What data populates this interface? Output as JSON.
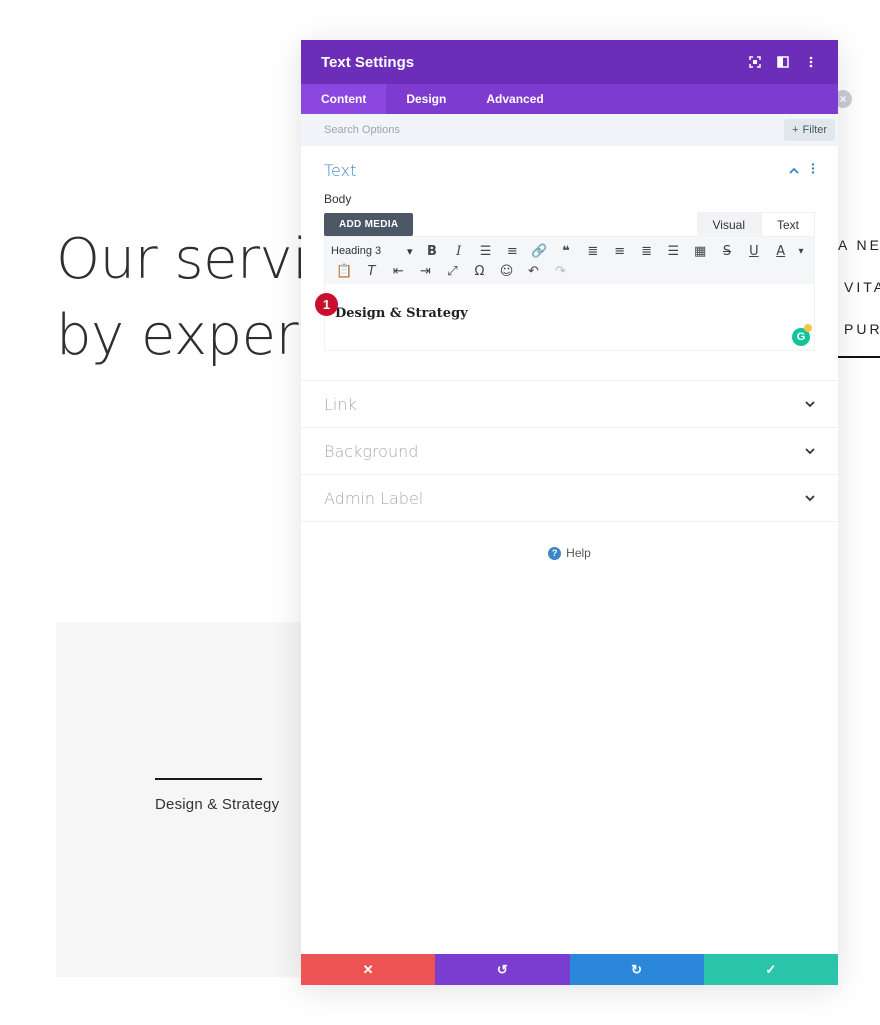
{
  "page": {
    "heading_line1": "Our servi",
    "heading_line2": "by expert",
    "card_text": "Design & Strategy",
    "right_texts": [
      "A NEC",
      "VITA",
      "PURU"
    ]
  },
  "modal": {
    "title": "Text Settings",
    "icons": [
      "focus-icon",
      "split-view-icon",
      "more-icon"
    ],
    "tabs": [
      {
        "label": "Content",
        "active": true
      },
      {
        "label": "Design",
        "active": false
      },
      {
        "label": "Advanced",
        "active": false
      }
    ],
    "search": {
      "placeholder": "Search Options"
    },
    "filter_label": "Filter",
    "text_section": {
      "title": "Text",
      "body_label": "Body",
      "add_media": "ADD MEDIA",
      "editor_tabs": {
        "visual": "Visual",
        "text": "Text"
      },
      "format_select": "Heading 3",
      "content": "Design & Strategy",
      "step_badge": "1"
    },
    "sections": [
      {
        "title": "Link"
      },
      {
        "title": "Background"
      },
      {
        "title": "Admin Label"
      }
    ],
    "help_label": "Help",
    "footer_colors": {
      "cancel": "#ef5455",
      "undo": "#7b3cd0",
      "redo": "#2b87da",
      "save": "#29c4a9"
    },
    "accent": "#6c2eb9"
  }
}
